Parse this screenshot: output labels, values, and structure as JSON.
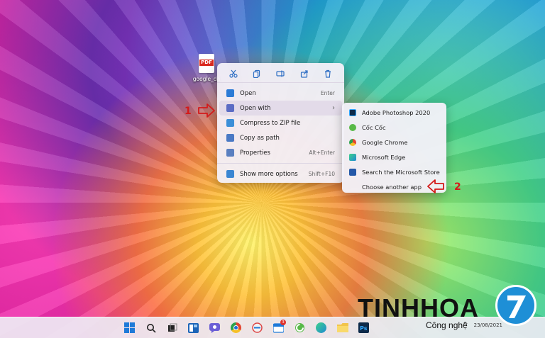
{
  "desktop": {
    "file_icon_tag": "PDF",
    "file_name": "google_da"
  },
  "context_menu": {
    "actions": [
      {
        "icon": "cut-icon"
      },
      {
        "icon": "copy-icon"
      },
      {
        "icon": "rename-icon"
      },
      {
        "icon": "share-icon"
      },
      {
        "icon": "delete-icon"
      }
    ],
    "items": [
      {
        "label": "Open",
        "shortcut": "Enter",
        "icon_color": "#2b7bd6"
      },
      {
        "label": "Open with",
        "shortcut": "",
        "icon_color": "#5b6cc4",
        "has_submenu": true
      },
      {
        "label": "Compress to ZIP file",
        "shortcut": "",
        "icon_color": "#3b8fd8"
      },
      {
        "label": "Copy as path",
        "shortcut": "",
        "icon_color": "#4a79c4"
      },
      {
        "label": "Properties",
        "shortcut": "Alt+Enter",
        "icon_color": "#5a7fc0"
      },
      {
        "label": "Show more options",
        "shortcut": "Shift+F10",
        "icon_color": "#3a86d2"
      }
    ],
    "submenu_chevron": "›"
  },
  "submenu": {
    "items": [
      {
        "label": "Adobe Photoshop 2020",
        "icon_color": "#0e2a4a"
      },
      {
        "label": "Cốc Cốc",
        "icon_color": "#58b947"
      },
      {
        "label": "Google Chrome",
        "icon_color": "#e2452f"
      },
      {
        "label": "Microsoft Edge",
        "icon_color": "#1f8ad2"
      },
      {
        "label": "Search the Microsoft Store",
        "icon_color": "#2458a8"
      },
      {
        "label": "Choose another app",
        "icon_color": ""
      }
    ]
  },
  "annotations": {
    "step1": "1",
    "step2": "2"
  },
  "taskbar": {
    "badge_count": "3",
    "tray_time": "23/08/2021"
  },
  "watermark": {
    "brand": "TINHHOA",
    "sub": "Công nghệ"
  }
}
